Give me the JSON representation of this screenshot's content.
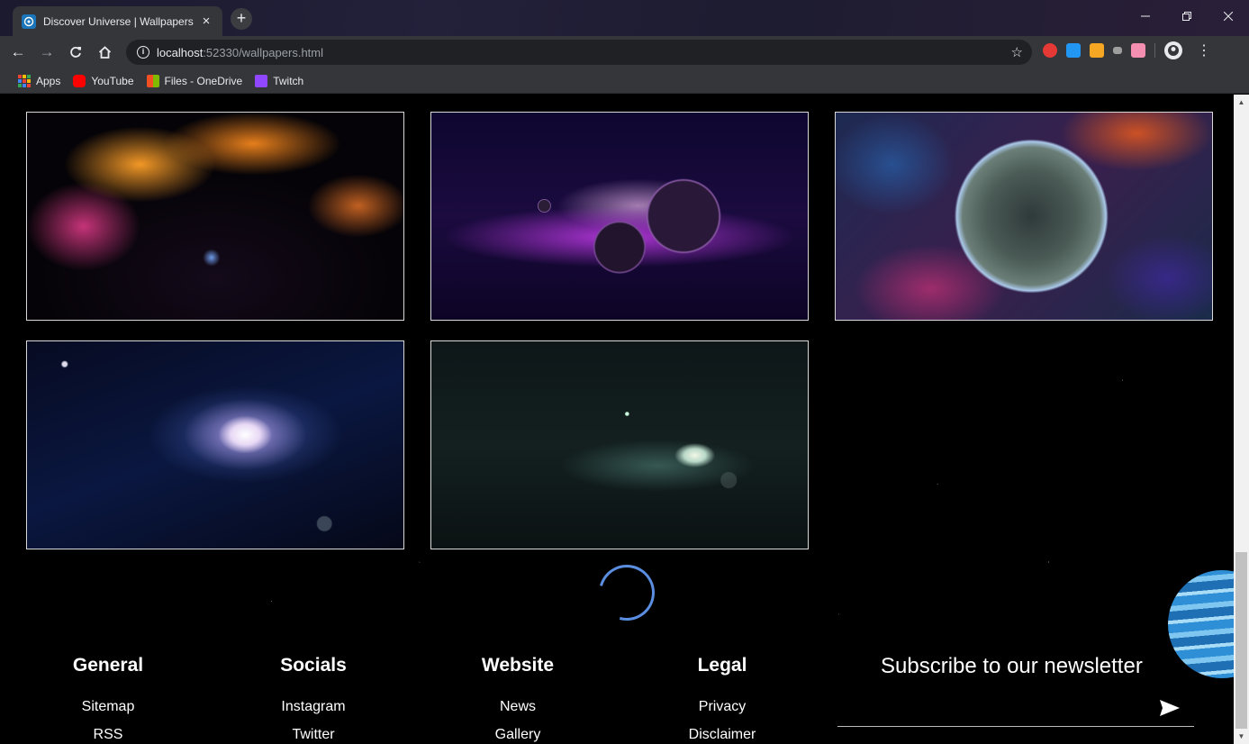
{
  "browser": {
    "tab_title": "Discover Universe | Wallpapers",
    "tab_close": "×",
    "new_tab": "+",
    "url_host": "localhost",
    "url_rest": ":52330/wallpapers.html",
    "bookmarks": [
      {
        "label": "Apps"
      },
      {
        "label": "YouTube"
      },
      {
        "label": "Files - OneDrive"
      },
      {
        "label": "Twitch"
      }
    ]
  },
  "wallpapers": [
    {
      "name": "orange-pink-nebula"
    },
    {
      "name": "purple-twin-planets"
    },
    {
      "name": "earth-planet-nebula"
    },
    {
      "name": "spiral-galaxy"
    },
    {
      "name": "teal-galaxy-moon"
    }
  ],
  "footer": {
    "columns": [
      {
        "heading": "General",
        "links": [
          "Sitemap",
          "RSS"
        ]
      },
      {
        "heading": "Socials",
        "links": [
          "Instagram",
          "Twitter"
        ]
      },
      {
        "heading": "Website",
        "links": [
          "News",
          "Gallery"
        ]
      },
      {
        "heading": "Legal",
        "links": [
          "Privacy",
          "Disclaimer"
        ]
      }
    ],
    "newsletter": {
      "title": "Subscribe to our newsletter",
      "input_value": "",
      "placeholder": ""
    }
  },
  "colors": {
    "spinner": "#5b8ee0",
    "planet": "#2e8fd6",
    "tab_bg": "#35363a"
  }
}
